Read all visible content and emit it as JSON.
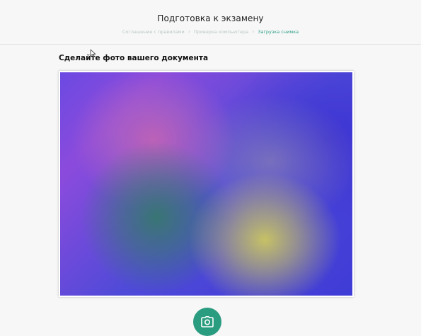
{
  "header": {
    "title": "Подготовка к экзамену",
    "breadcrumb": [
      {
        "label": "Соглашение с правилами",
        "active": false
      },
      {
        "label": "Проверка компьютера",
        "active": false
      },
      {
        "label": "Загрузка снимка",
        "active": true
      }
    ]
  },
  "main": {
    "section_title": "Сделайте фото вашего документа",
    "camera_icon": "camera-icon"
  },
  "colors": {
    "accent": "#2a9c80",
    "breadcrumb_active": "#2f9f86",
    "breadcrumb_inactive": "#b9c9c2",
    "background": "#f7f7f7"
  }
}
